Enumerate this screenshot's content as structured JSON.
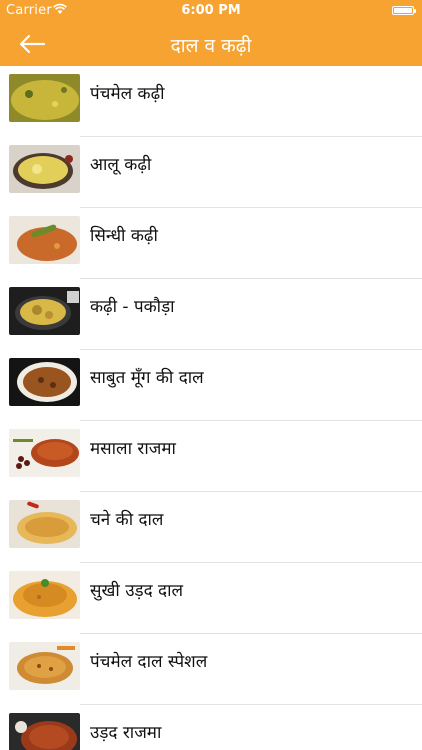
{
  "status_bar": {
    "carrier": "Carrier",
    "time": "6:00 PM"
  },
  "nav": {
    "title": "दाल व कढ़ी",
    "back_icon": "arrow-left-icon",
    "color": "#f7a332"
  },
  "items": [
    {
      "label": "पंचमेल कढ़ी"
    },
    {
      "label": "आलू कढ़ी"
    },
    {
      "label": "सिन्धी कढ़ी"
    },
    {
      "label": "कढ़ी - पकौड़ा"
    },
    {
      "label": "साबुत मूँग की दाल"
    },
    {
      "label": "मसाला राजमा"
    },
    {
      "label": "चने की दाल"
    },
    {
      "label": "सुखी उड़द दाल"
    },
    {
      "label": "पंचमेल दाल स्पेशल"
    },
    {
      "label": "उड़द राजमा"
    }
  ]
}
